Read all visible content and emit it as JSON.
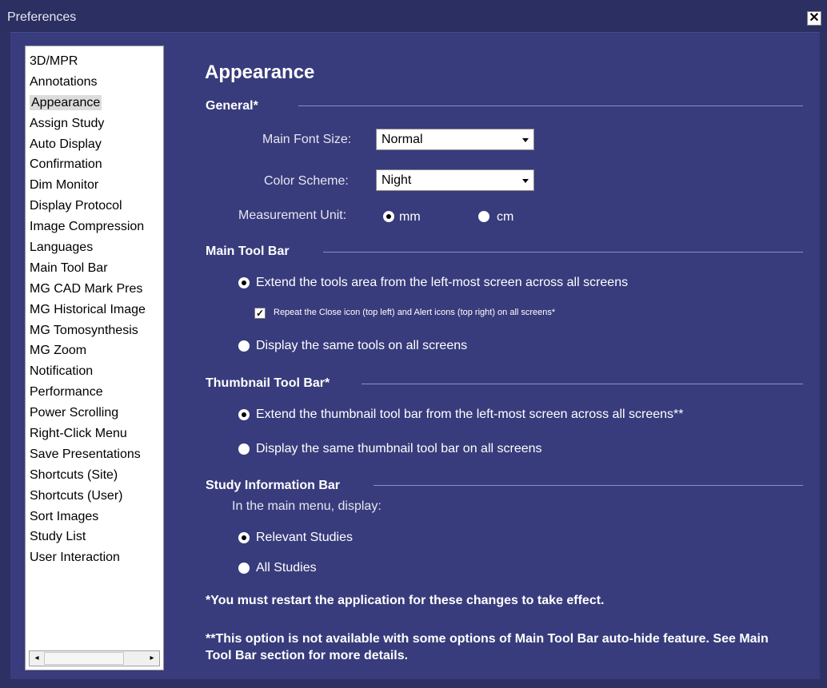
{
  "window": {
    "title": "Preferences",
    "close_label": "✕"
  },
  "sidebar": {
    "items": [
      "3D/MPR",
      "Annotations",
      "Appearance",
      "Assign Study",
      "Auto Display",
      "Confirmation",
      "Dim Monitor",
      "Display Protocol",
      "Image Compression",
      "Languages",
      "Main Tool Bar",
      "MG CAD Mark Pres",
      "MG Historical Image",
      "MG Tomosynthesis",
      "MG Zoom",
      "Notification",
      "Performance",
      "Power Scrolling",
      "Right-Click Menu",
      "Save Presentations",
      "Shortcuts (Site)",
      "Shortcuts (User)",
      "Sort Images",
      "Study List",
      "User Interaction"
    ],
    "selected": "Appearance",
    "scroll_left": "◂",
    "scroll_right": "▸"
  },
  "main": {
    "heading": "Appearance",
    "general": {
      "title": "General*",
      "font_size_label": "Main Font Size:",
      "font_size_value": "Normal",
      "color_scheme_label": "Color Scheme:",
      "color_scheme_value": "Night",
      "unit_label": "Measurement Unit:",
      "unit_mm": "mm",
      "unit_cm": "cm",
      "unit_selected": "mm"
    },
    "main_tool_bar": {
      "title": "Main Tool Bar",
      "opt_extend": "Extend the tools area from the left-most screen across all screens",
      "opt_repeat": "Repeat the Close icon (top left) and Alert icons (top right) on all screens*",
      "opt_same": "Display the same tools on all screens",
      "selected": "extend",
      "repeat_checked": true
    },
    "thumbnail_tool_bar": {
      "title": "Thumbnail Tool Bar*",
      "opt_extend": "Extend the thumbnail tool bar from the left-most screen across all screens**",
      "opt_same": "Display the same thumbnail tool bar on all screens",
      "selected": "extend"
    },
    "study_info_bar": {
      "title": "Study Information Bar",
      "prompt": "In the main menu, display:",
      "opt_relevant": "Relevant Studies",
      "opt_all": "All Studies",
      "selected": "relevant"
    },
    "note1": "*You must restart the application for these changes to take effect.",
    "note2": "**This option is not available with some options of Main Tool Bar auto-hide feature. See Main Tool Bar section for more details."
  }
}
